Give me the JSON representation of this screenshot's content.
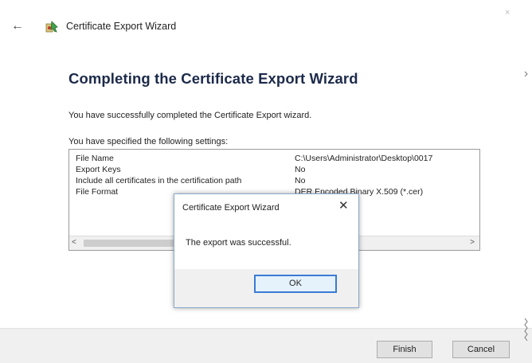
{
  "window": {
    "title": "Certificate Export Wizard",
    "back_glyph": "←",
    "close_glyph": "×"
  },
  "main": {
    "heading": "Completing the Certificate Export Wizard",
    "sentence": "You have successfully completed the Certificate Export wizard.",
    "settings_label": "You have specified the following settings:",
    "settings": [
      {
        "name": "File Name",
        "value": "C:\\Users\\Administrator\\Desktop\\0017"
      },
      {
        "name": "Export Keys",
        "value": "No"
      },
      {
        "name": "Include all certificates in the certification path",
        "value": "No"
      },
      {
        "name": "File Format",
        "value": "DER Encoded Binary X.509 (*.cer)"
      }
    ],
    "scroll_left_glyph": "<",
    "scroll_right_glyph": ">"
  },
  "footer": {
    "finish_label": "Finish",
    "cancel_label": "Cancel"
  },
  "dialog": {
    "title": "Certificate Export Wizard",
    "close_glyph": "✕",
    "message": "The export was successful.",
    "ok_label": "OK"
  },
  "icons": {
    "app_icon": "certificate-wizard-icon",
    "back": "back-arrow-icon"
  },
  "colors": {
    "heading": "#1c2a4a",
    "dialog_border": "#8aa8c8",
    "focus_border": "#3a7bd5",
    "button_face": "#e1e1e1",
    "footer_bg": "#f0f0f0"
  }
}
